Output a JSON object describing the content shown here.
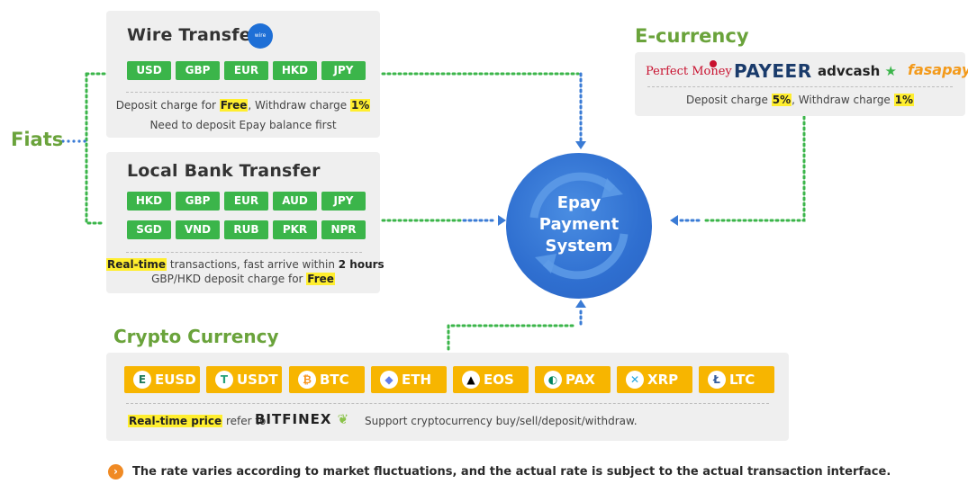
{
  "fiats": {
    "label": "Fiats"
  },
  "wire_transfer": {
    "title": "Wire Transfer",
    "currencies": [
      "USD",
      "GBP",
      "EUR",
      "HKD",
      "JPY"
    ],
    "note1_pre": "Deposit charge for ",
    "note1_free": "Free",
    "note1_mid": ", Withdraw charge ",
    "note1_pct": "1%",
    "note2": "Need to deposit Epay balance first"
  },
  "local_bank": {
    "title": "Local Bank Transfer",
    "currencies_row1": [
      "HKD",
      "GBP",
      "EUR",
      "AUD",
      "JPY"
    ],
    "currencies_row2": [
      "SGD",
      "VND",
      "RUB",
      "PKR",
      "NPR"
    ],
    "note1_hl": "Real-time",
    "note1_mid": " transactions, fast arrive within ",
    "note1_bold": "2 hours",
    "note2_pre": "GBP/HKD deposit charge for ",
    "note2_free": "Free"
  },
  "ecurrency": {
    "label": "E-currency",
    "logos": [
      "Perfect Money",
      "PAYEER",
      "advcash",
      "fasapay"
    ],
    "note_pre": "Deposit charge ",
    "note_dep": "5%",
    "note_mid": ", Withdraw charge ",
    "note_wd": "1%"
  },
  "epay": {
    "line1": "Epay",
    "line2": "Payment",
    "line3": "System"
  },
  "crypto": {
    "label": "Crypto Currency",
    "coins": [
      {
        "name": "EUSD",
        "icon": "E",
        "icon_color": "#1f7a5a"
      },
      {
        "name": "USDT",
        "icon": "T",
        "icon_color": "#26a17b"
      },
      {
        "name": "BTC",
        "icon": "₿",
        "icon_color": "#f7931a"
      },
      {
        "name": "ETH",
        "icon": "◆",
        "icon_color": "#627eea"
      },
      {
        "name": "EOS",
        "icon": "▲",
        "icon_color": "#000000"
      },
      {
        "name": "PAX",
        "icon": "◐",
        "icon_color": "#00845d"
      },
      {
        "name": "XRP",
        "icon": "✕",
        "icon_color": "#23a5e0"
      },
      {
        "name": "LTC",
        "icon": "Ł",
        "icon_color": "#345d9d"
      }
    ],
    "note_hl": "Real-time price",
    "note_mid": " refer to ",
    "bitfinex": "BITFINEX",
    "note_end": "Support cryptocurrency buy/sell/deposit/withdraw."
  },
  "footer": {
    "text": "The rate varies according to market fluctuations, and the actual rate is subject to the actual transaction interface."
  },
  "colors": {
    "green": "#3bb54a",
    "label_green": "#6aa33b",
    "blue": "#2f6fd0",
    "coin": "#f7b500",
    "highlight": "#ffee2e"
  }
}
